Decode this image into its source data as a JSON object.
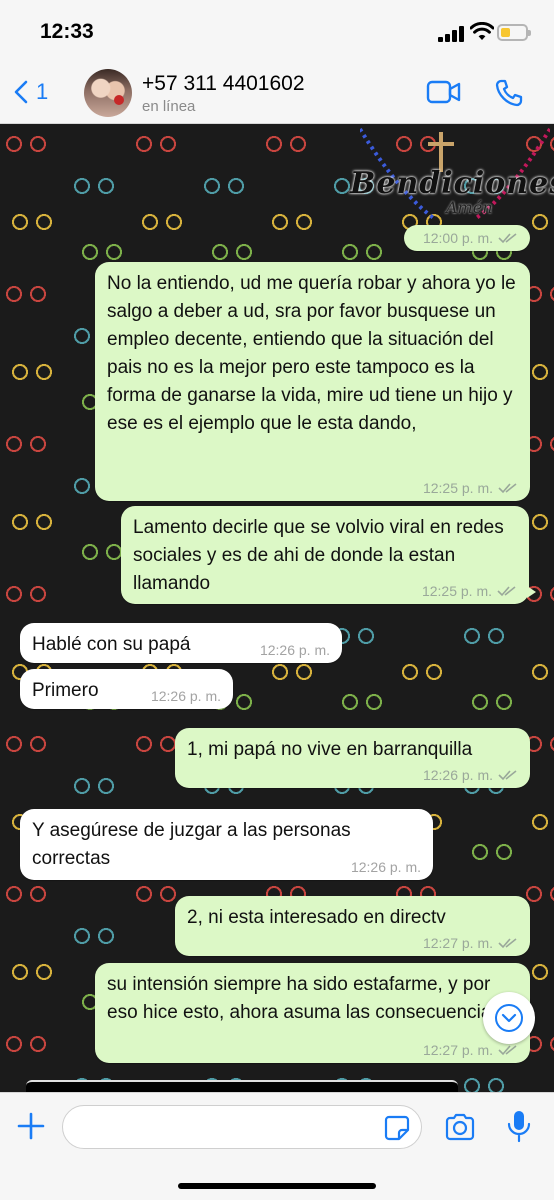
{
  "status_bar": {
    "time": "12:33",
    "battery_level": 0.2,
    "battery_color": "#f7c631"
  },
  "header": {
    "back_count": "1",
    "contact_name": "+57 311 4401602",
    "contact_status": "en línea",
    "accent_color": "#1a7cf5",
    "icons": [
      "chevron-left-icon",
      "video-camera-icon",
      "phone-icon"
    ]
  },
  "chat": {
    "wallpaper_text": "Bendiciones",
    "wallpaper_subtext": "Amén",
    "messages": [
      {
        "direction": "out",
        "text": "",
        "time": "12:00 p. m.",
        "status": "read"
      },
      {
        "direction": "out",
        "text": "No la entiendo, ud me quería robar y ahora yo le salgo a deber a ud, sra por favor busquese un empleo decente, entiendo que la situación del pais no es la mejor pero este tampoco es la forma de ganarse la vida, mire ud tiene un hijo y ese es el ejemplo que le esta dando,",
        "time": "12:25 p. m.",
        "status": "read"
      },
      {
        "direction": "out",
        "text": "Lamento decirle que se volvio viral en redes sociales y es de ahi de donde la estan llamando",
        "time": "12:25 p. m.",
        "status": "read"
      },
      {
        "direction": "in",
        "text": "Hablé con su papá",
        "time": "12:26 p. m."
      },
      {
        "direction": "in",
        "text": "Primero",
        "time": "12:26 p. m."
      },
      {
        "direction": "out",
        "text": "1, mi papá no vive en barranquilla",
        "time": "12:26 p. m.",
        "status": "read"
      },
      {
        "direction": "in",
        "text": "Y asegúrese de juzgar a las personas correctas",
        "time": "12:26 p. m."
      },
      {
        "direction": "out",
        "text": "2, ni esta interesado en directv",
        "time": "12:27 p. m.",
        "status": "read"
      },
      {
        "direction": "out",
        "text": "su intensión siempre ha sido estafarme, y por eso hice esto, ahora asuma las consecuencias",
        "time": "12:27 p. m.",
        "status": "read"
      }
    ],
    "colors": {
      "outgoing": "#dcf8c6",
      "incoming": "#ffffff"
    }
  },
  "input_bar": {
    "message_value": "",
    "icons": [
      "plus-icon",
      "sticker-icon",
      "camera-icon",
      "microphone-icon"
    ]
  }
}
